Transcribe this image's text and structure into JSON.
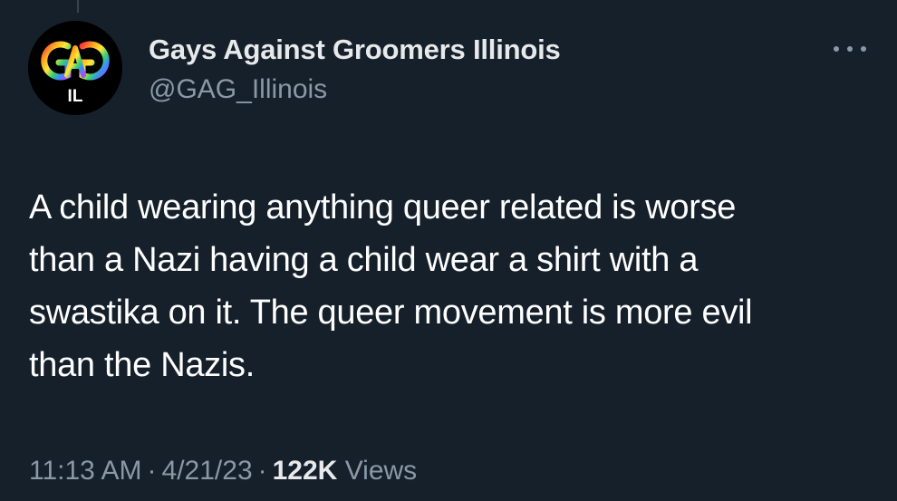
{
  "tweet": {
    "author": {
      "display_name": "Gays Against Groomers Illinois",
      "handle": "@GAG_Illinois",
      "avatar_badge": "IL",
      "avatar_icon": "gag-logo-icon"
    },
    "more_icon": "more-options-icon",
    "text": "A child wearing anything queer related is worse\nthan a Nazi having a child wear a shirt with a\nswastika on it. The queer movement is more evil\nthan the Nazis.",
    "time": "11:13 AM",
    "date": "4/21/23",
    "separator": "·",
    "views_count": "122K",
    "views_label": "Views"
  },
  "colors": {
    "background": "#15202b",
    "text": "#e7e9ea",
    "secondary_text": "#8b98a5",
    "avatar_background": "#000000"
  }
}
